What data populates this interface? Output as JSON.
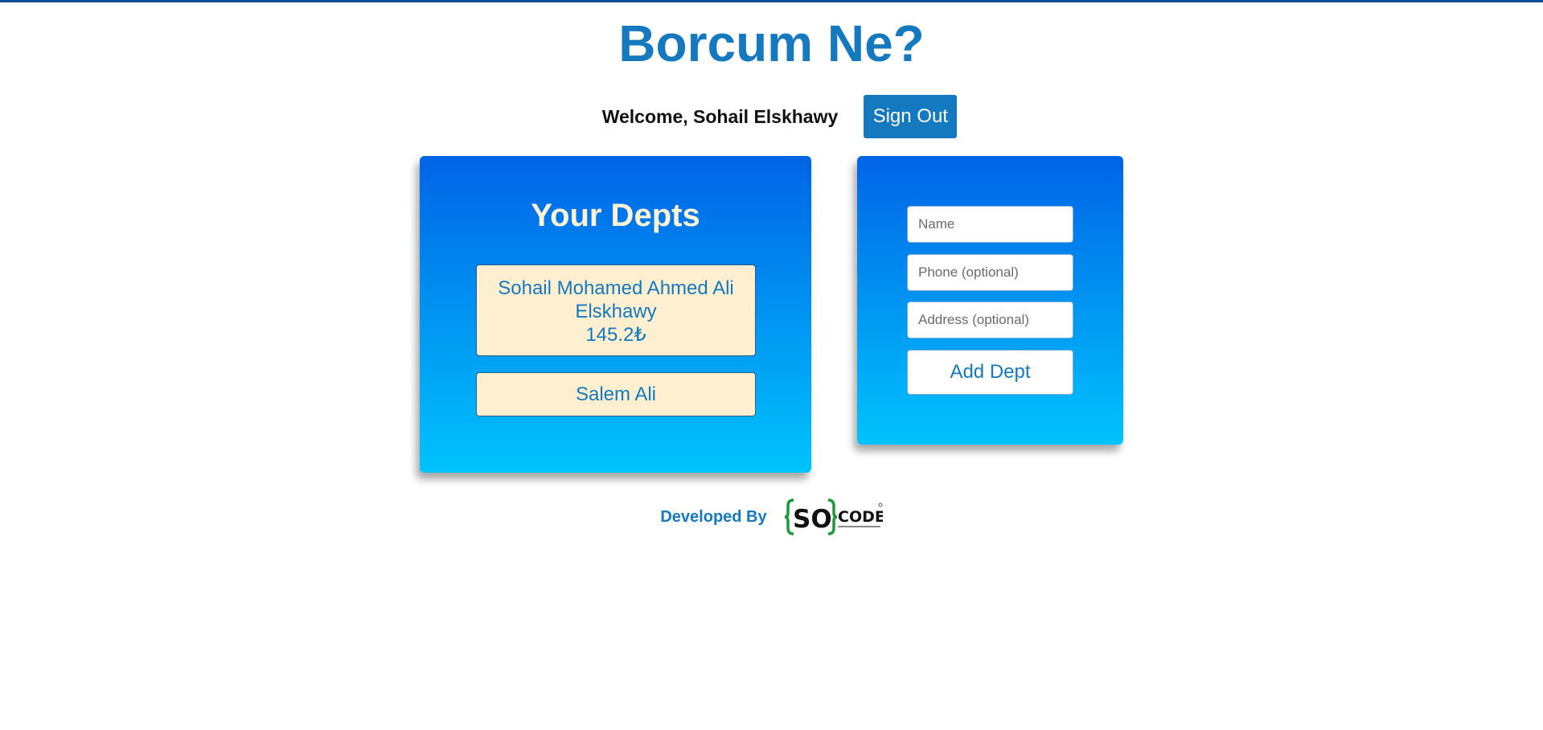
{
  "app": {
    "title": "Borcum Ne?"
  },
  "header": {
    "welcome": "Welcome, Sohail Elskhawy",
    "signout_label": "Sign Out"
  },
  "depts": {
    "title": "Your Depts",
    "items": [
      {
        "name_line1": "Sohail Mohamed Ahmed Ali",
        "name_line2": "Elskhawy",
        "amount": "145.2₺"
      },
      {
        "name_line1": "Salem Ali"
      }
    ]
  },
  "form": {
    "name_placeholder": "Name",
    "phone_placeholder": "Phone (optional)",
    "address_placeholder": "Address (optional)",
    "add_label": "Add Dept"
  },
  "footer": {
    "developed_by": "Developed By",
    "logo_text_so": "SO",
    "logo_text_code": "CODE"
  },
  "colors": {
    "brand": "#1479bf",
    "card_top": "#0064e6",
    "card_bottom": "#00c3fc",
    "item_bg": "#fdefd0"
  }
}
